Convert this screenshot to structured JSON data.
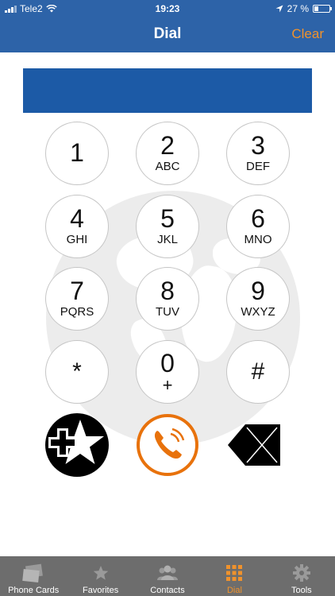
{
  "status": {
    "carrier": "Tele2",
    "time": "19:23",
    "battery": "27 %",
    "battery_level": 0.27
  },
  "nav": {
    "title": "Dial",
    "clear_label": "Clear"
  },
  "display": {
    "number": ""
  },
  "keypad": {
    "k1": {
      "digit": "1",
      "letters": ""
    },
    "k2": {
      "digit": "2",
      "letters": "ABC"
    },
    "k3": {
      "digit": "3",
      "letters": "DEF"
    },
    "k4": {
      "digit": "4",
      "letters": "GHI"
    },
    "k5": {
      "digit": "5",
      "letters": "JKL"
    },
    "k6": {
      "digit": "6",
      "letters": "MNO"
    },
    "k7": {
      "digit": "7",
      "letters": "PQRS"
    },
    "k8": {
      "digit": "8",
      "letters": "TUV"
    },
    "k9": {
      "digit": "9",
      "letters": "WXYZ"
    },
    "kstar": {
      "digit": "*"
    },
    "k0": {
      "digit": "0",
      "letters": "+"
    },
    "khash": {
      "digit": "#"
    }
  },
  "actions": {
    "add_favorite_icon": "star-plus-icon",
    "call_icon": "phone-call-icon",
    "delete_icon": "backspace-icon",
    "call_color": "#e8720c"
  },
  "tabs": {
    "phone_cards": {
      "label": "Phone Cards",
      "icon": "phone-cards-icon"
    },
    "favorites": {
      "label": "Favorites",
      "icon": "star-icon"
    },
    "contacts": {
      "label": "Contacts",
      "icon": "contacts-icon"
    },
    "dial": {
      "label": "Dial",
      "icon": "keypad-icon",
      "active_color": "#f0922c"
    },
    "tools": {
      "label": "Tools",
      "icon": "gear-icon"
    }
  },
  "colors": {
    "header": "#2d63a8",
    "display": "#1c5aa6",
    "accent": "#f0922c"
  }
}
